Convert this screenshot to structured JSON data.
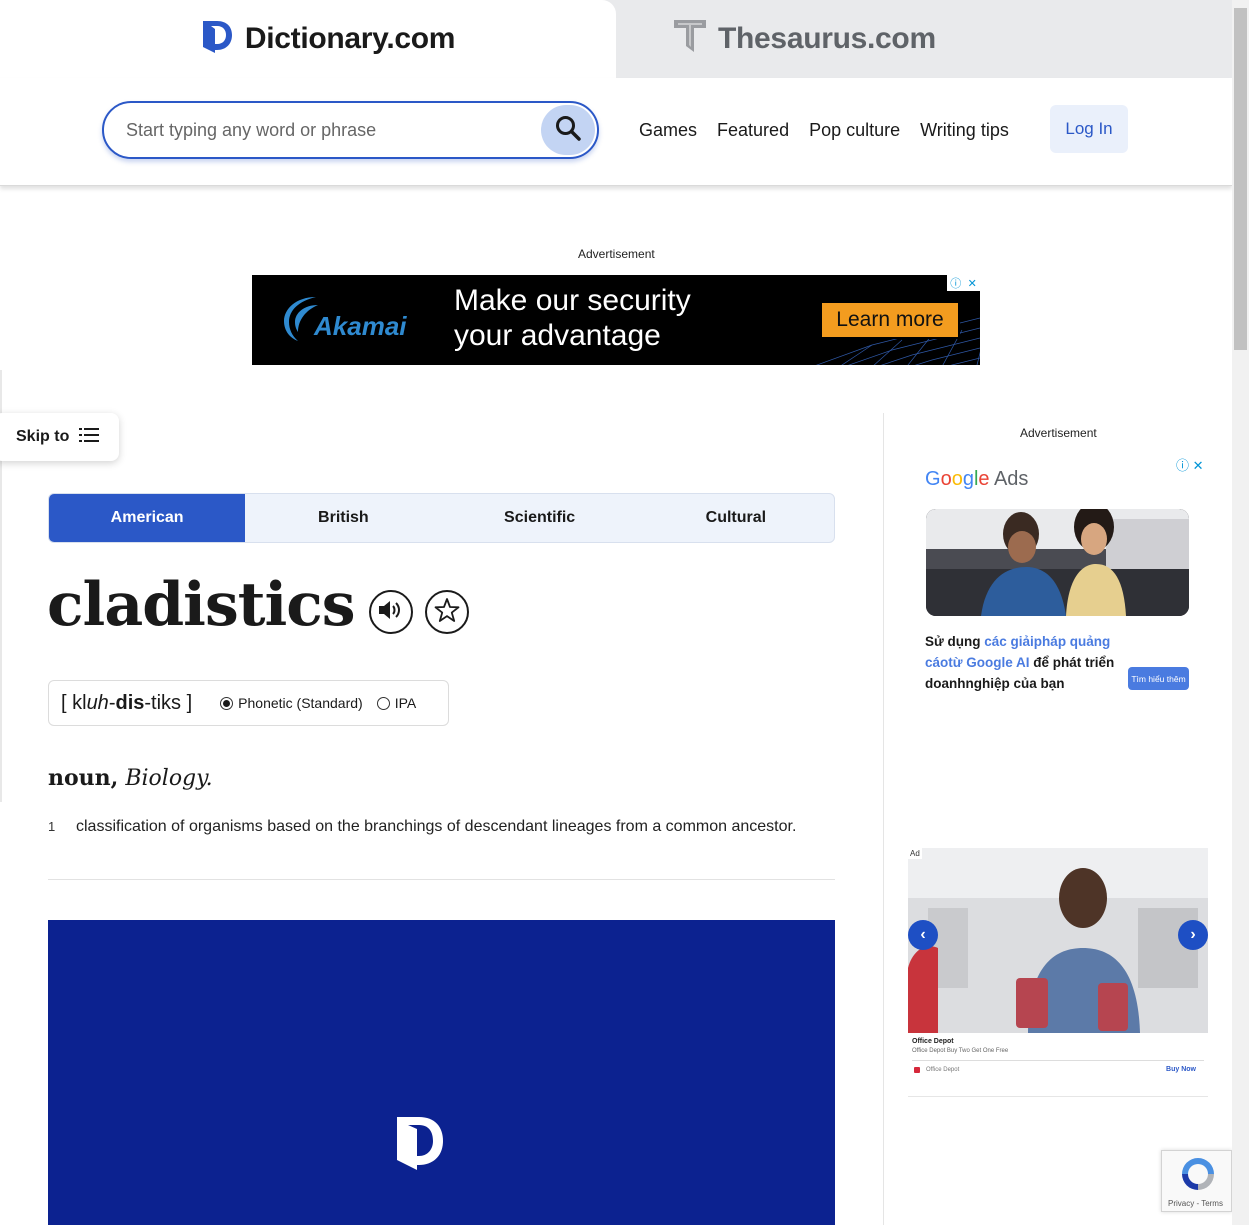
{
  "sites": {
    "dictionary": "Dictionary.com",
    "thesaurus": "Thesaurus.com"
  },
  "header": {
    "search_placeholder": "Start typing any word or phrase",
    "nav": [
      "Games",
      "Featured",
      "Pop culture",
      "Writing tips"
    ],
    "login": "Log In"
  },
  "ads": {
    "label": "Advertisement",
    "banner": {
      "brand": "Akamai",
      "headline_1": "Make our security",
      "headline_2": "your advantage",
      "cta": "Learn more"
    },
    "google_ads": {
      "brand_1": "G",
      "brand_2": "o",
      "brand_3": "o",
      "brand_4": "g",
      "brand_5": "l",
      "brand_6": "e",
      "brand_rest": " Ads",
      "text_1": "Sử dụng ",
      "text_hl": "các giảipháp quảng cáotừ Google AI",
      "text_2": " để phát triển doanhnghiệp của bạn",
      "cta": "Tìm hiểu thêm"
    },
    "office_depot": {
      "tag": "Ad",
      "brand": "Office Depot",
      "subline": "Office Depot Buy Two Get One Free",
      "source": "Office Depot",
      "cta": "Buy Now"
    }
  },
  "skip_to": "Skip to",
  "dialect_tabs": [
    "American",
    "British",
    "Scientific",
    "Cultural"
  ],
  "active_dialect": "American",
  "entry": {
    "word": "cladistics",
    "pron_open": "[ kl",
    "pron_uh": "uh",
    "pron_dash1": "-",
    "pron_dis": "dis",
    "pron_rest": "-tiks ]",
    "option_phonetic": "Phonetic (Standard)",
    "option_ipa": "IPA",
    "pos": "noun,",
    "field": "Biology.",
    "definitions": [
      {
        "num": "1",
        "text": "classification of organisms based on the branchings of descendant lineages from a common ancestor."
      }
    ]
  },
  "recaptcha": "Privacy - Terms",
  "colors": {
    "accent": "#2b58c7",
    "video_bg": "#0c2290",
    "banner_cta": "#f39c1f"
  }
}
